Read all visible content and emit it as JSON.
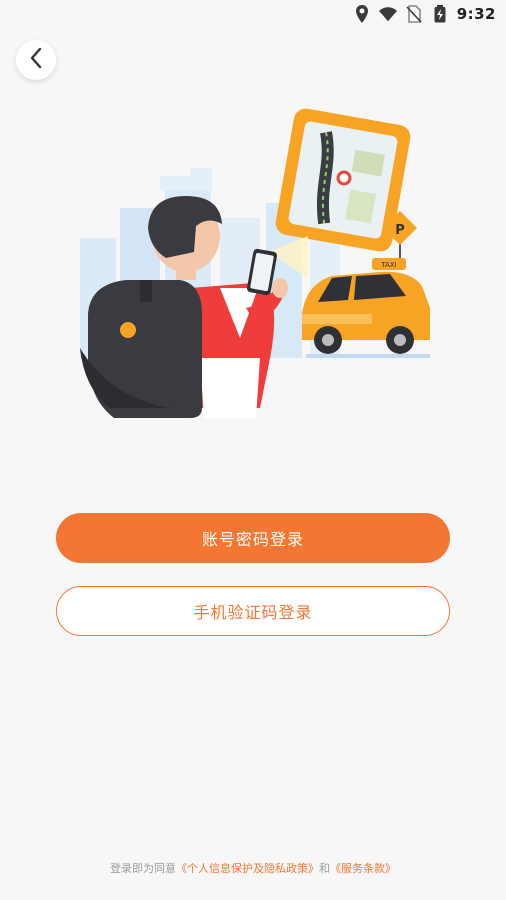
{
  "status_bar": {
    "time": "9:32",
    "icons": [
      "location-icon",
      "wifi-icon",
      "no-sim-icon",
      "battery-charging-icon"
    ]
  },
  "header": {
    "back_icon": "chevron-left-icon"
  },
  "hero": {
    "illustration": "man-with-phone-and-taxi",
    "taxi_sign": "TAXI",
    "parking_sign": "P"
  },
  "actions": {
    "password_login": "账号密码登录",
    "sms_login": "手机验证码登录"
  },
  "footer": {
    "prefix": "登录即为同意",
    "privacy_link": "《个人信息保护及隐私政策》",
    "conjunction": "和",
    "terms_link": "《服务条款》"
  },
  "colors": {
    "accent": "#f47633",
    "background": "#f7f7f7",
    "footer_text": "#9a9a9a"
  }
}
